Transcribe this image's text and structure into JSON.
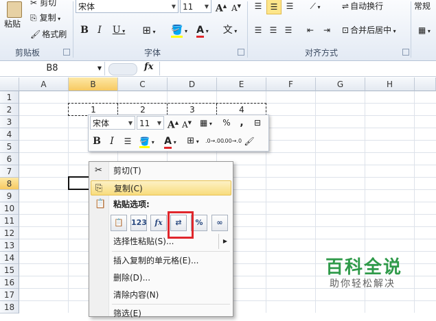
{
  "ribbon": {
    "clipboard": {
      "paste": "粘贴",
      "cut": "剪切",
      "copy": "复制",
      "format_painter": "格式刷",
      "group": "剪贴板"
    },
    "font": {
      "name": "宋体",
      "size": "11",
      "bold": "B",
      "italic": "I",
      "underline": "U",
      "group": "字体",
      "grow": "A",
      "shrink": "A",
      "fontcolor": "A",
      "phonetic": "文"
    },
    "align": {
      "wrap": "自动换行",
      "merge": "合并后居中",
      "group": "对齐方式"
    },
    "number": {
      "format": "常规"
    }
  },
  "formula_bar": {
    "name_box": "B8",
    "fx": "fx",
    "value": ""
  },
  "grid": {
    "columns": [
      "A",
      "B",
      "C",
      "D",
      "E",
      "F",
      "G",
      "H"
    ],
    "rows": [
      "1",
      "2",
      "3",
      "4",
      "5",
      "6",
      "7",
      "8",
      "9",
      "10",
      "11",
      "12",
      "13",
      "14",
      "15",
      "16",
      "17",
      "18"
    ],
    "row2_values": [
      "1",
      "2",
      "3",
      "4"
    ]
  },
  "mini_toolbar": {
    "font": "宋体",
    "size": "11",
    "percent": "%",
    "comma": ",",
    "bold": "B",
    "italic": "I",
    "fontcolor": "A",
    "inc_decimal": ".0→.00",
    "dec_decimal": ".00→.0"
  },
  "context_menu": {
    "cut": "剪切(T)",
    "copy": "复制(C)",
    "paste_options_label": "粘贴选项:",
    "paste_special": "选择性粘贴(S)...",
    "insert_copied": "插入复制的单元格(E)...",
    "delete": "删除(D)...",
    "clear": "清除内容(N)",
    "filter": "筛选(E)",
    "paste_options": [
      "",
      "123",
      "fx",
      "",
      "%",
      "∞"
    ]
  },
  "watermark": {
    "title": "百科全说",
    "subtitle": "助你轻松解决"
  },
  "colors": {
    "highlight": "#e0262b",
    "brand_green": "#2f9a4a"
  }
}
